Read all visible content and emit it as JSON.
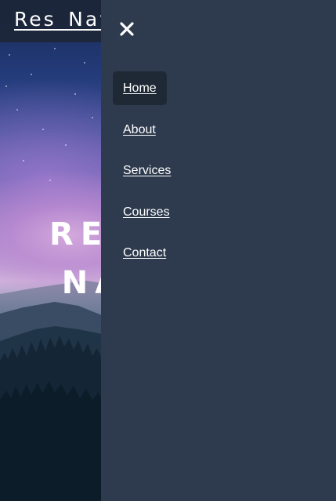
{
  "header": {
    "brand": "Res_Nav"
  },
  "hero": {
    "title": "RES\nNA"
  },
  "sidebar": {
    "close_icon": "close-icon",
    "active_index": 0,
    "items": [
      {
        "label": "Home"
      },
      {
        "label": "About"
      },
      {
        "label": "Services"
      },
      {
        "label": "Courses"
      },
      {
        "label": "Contact"
      }
    ]
  },
  "colors": {
    "sidebar_bg": "#2e3b4e",
    "active_item_bg": "#1f2936",
    "text": "#ffffff"
  }
}
